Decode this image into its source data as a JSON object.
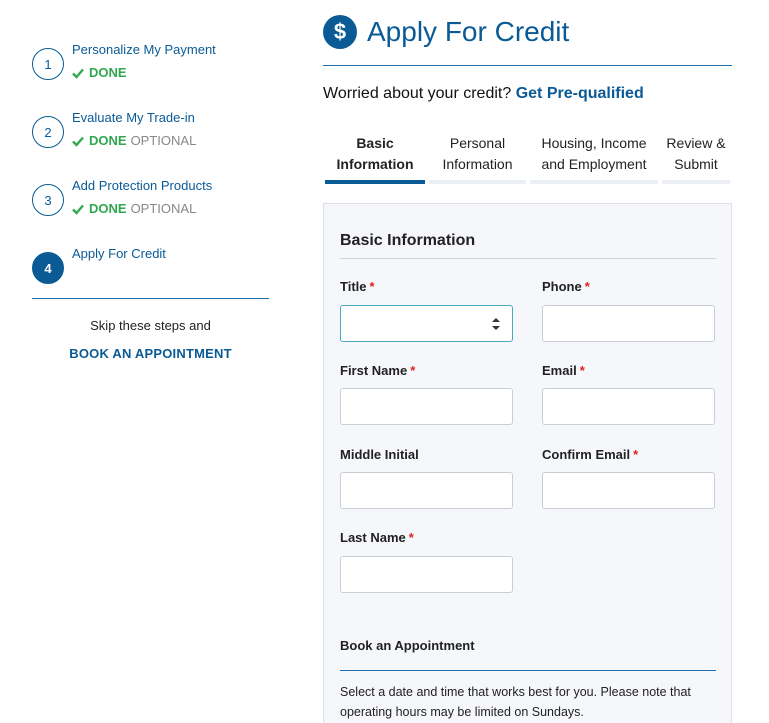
{
  "sidebar": {
    "steps": [
      {
        "number": "1",
        "title": "Personalize My Payment",
        "status": "DONE",
        "optional": ""
      },
      {
        "number": "2",
        "title": "Evaluate My Trade-in",
        "status": "DONE",
        "optional": "OPTIONAL"
      },
      {
        "number": "3",
        "title": "Add Protection Products",
        "status": "DONE",
        "optional": "OPTIONAL"
      },
      {
        "number": "4",
        "title": "Apply For Credit",
        "status": "",
        "optional": ""
      }
    ],
    "skip_text": "Skip these steps and",
    "book_link": "BOOK AN APPOINTMENT"
  },
  "header": {
    "icon": "$",
    "title": "Apply For Credit"
  },
  "prequal": {
    "text": "Worried about your credit?",
    "link": "Get Pre-qualified"
  },
  "tabs": [
    {
      "line1": "Basic",
      "line2": "Information"
    },
    {
      "line1": "Personal",
      "line2": "Information"
    },
    {
      "line1": "Housing, Income",
      "line2": "and Employment"
    },
    {
      "line1": "Review &",
      "line2": "Submit"
    }
  ],
  "form": {
    "section_title": "Basic Information",
    "required_mark": "*",
    "labels": {
      "title": "Title",
      "phone": "Phone",
      "first_name": "First Name",
      "email": "Email",
      "middle_initial": "Middle Initial",
      "confirm_email": "Confirm Email",
      "last_name": "Last Name"
    },
    "values": {
      "title": "",
      "phone": "",
      "first_name": "",
      "email": "",
      "middle_initial": "",
      "confirm_email": "",
      "last_name": ""
    }
  },
  "appointment": {
    "title": "Book an Appointment",
    "text": "Select a date and time that works best for you. Please note that operating hours may be limited on Sundays."
  },
  "colors": {
    "brand_blue": "#0a5a96",
    "done_green": "#2fa84f",
    "required_red": "#dd2222",
    "panel_bg": "#f6f7fa"
  }
}
